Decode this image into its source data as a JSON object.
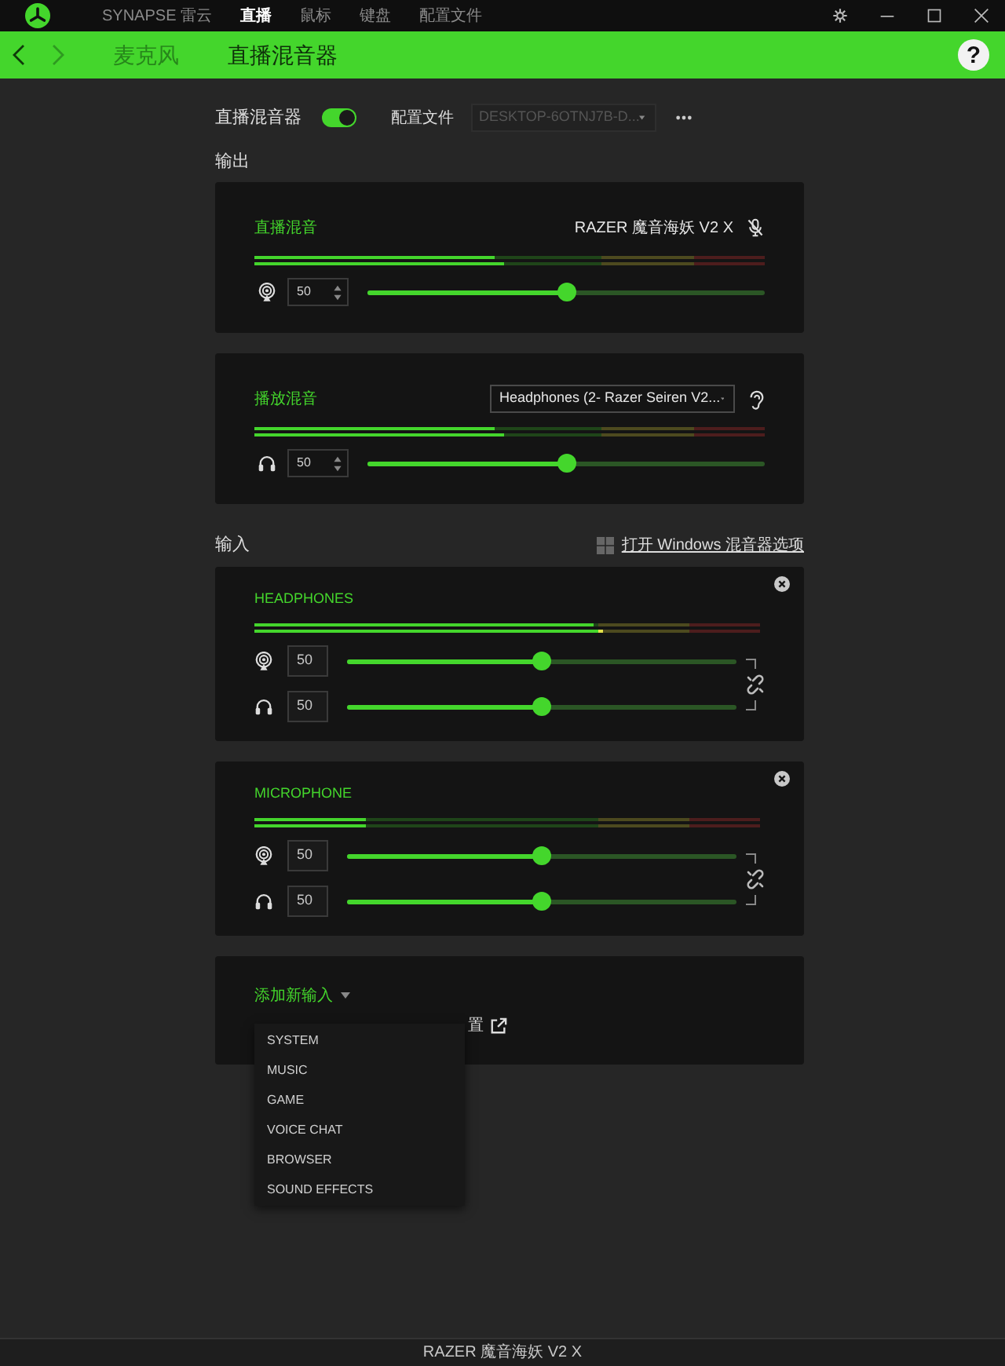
{
  "title_bar": {
    "tabs": [
      {
        "label": "SYNAPSE 雷云",
        "selected": false
      },
      {
        "label": "直播",
        "selected": true
      },
      {
        "label": "鼠标",
        "selected": false
      },
      {
        "label": "键盘",
        "selected": false
      },
      {
        "label": "配置文件",
        "selected": false
      }
    ]
  },
  "nav_bar": {
    "tabs": [
      {
        "label": "麦克风",
        "selected": false
      },
      {
        "label": "直播混音器",
        "selected": true
      }
    ],
    "help": "?"
  },
  "mixer": {
    "label": "直播混音器",
    "on": true,
    "profile_label": "配置文件",
    "profile": {
      "value": "DESKTOP-6OTNJ7B-D...",
      "disabled": true
    }
  },
  "output": {
    "heading": "输出",
    "mixes": [
      {
        "kind": "stream",
        "title": "直播混音",
        "device": "RAZER 魔音海妖 V2 X",
        "meter": [
          {
            "level": 0.47
          },
          {
            "level": 0.49
          }
        ],
        "volume": "50",
        "level": 0.5
      },
      {
        "kind": "playback",
        "title": "播放混音",
        "device": "Headphones (2- Razer Seiren V2...",
        "meter": [
          {
            "level": 0.47
          },
          {
            "level": 0.49
          }
        ],
        "volume": "50",
        "level": 0.5
      }
    ]
  },
  "input": {
    "heading": "输入",
    "link": "打开 Windows 混音器选项",
    "sources": [
      {
        "title": "HEADPHONES",
        "meter": [
          {
            "level": 0.67
          },
          {
            "level": 0.69
          }
        ],
        "channels": [
          {
            "kind": "stream",
            "volume": "50",
            "level": 0.5
          },
          {
            "kind": "monitor",
            "volume": "50",
            "level": 0.5
          }
        ]
      },
      {
        "title": "MICROPHONE",
        "meter": [
          {
            "level": 0.22
          },
          {
            "level": 0.22
          }
        ],
        "channels": [
          {
            "kind": "stream",
            "volume": "50",
            "level": 0.5
          },
          {
            "kind": "monitor",
            "volume": "50",
            "level": 0.5
          }
        ]
      }
    ]
  },
  "add_input": {
    "label": "添加新输入",
    "expanded": true,
    "note": "置",
    "menu": [
      "SYSTEM",
      "MUSIC",
      "GAME",
      "VOICE CHAT",
      "BROWSER",
      "SOUND EFFECTS"
    ]
  },
  "status_bar": {
    "device": "RAZER 魔音海妖 V2 X"
  }
}
